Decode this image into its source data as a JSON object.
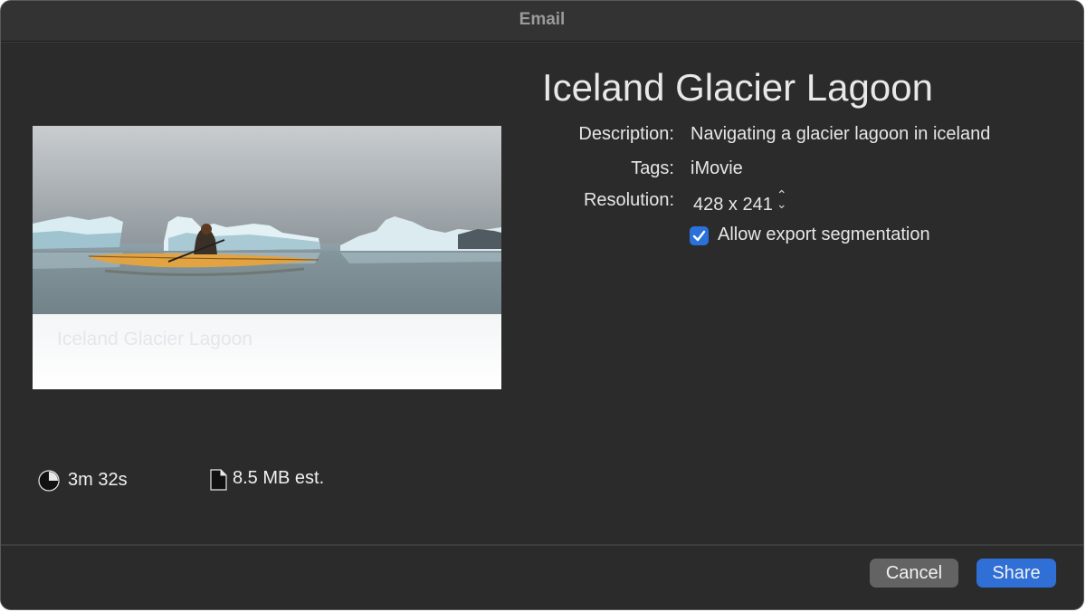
{
  "window": {
    "title": "Email"
  },
  "preview": {
    "caption": "Iceland Glacier Lagoon"
  },
  "details": {
    "title": "Iceland Glacier Lagoon",
    "description_label": "Description:",
    "description_value": "Navigating a glacier lagoon in iceland",
    "tags_label": "Tags:",
    "tags_value": "iMovie",
    "resolution_label": "Resolution:",
    "resolution_value": "428 x 241",
    "export_segmentation_label": "Allow export segmentation",
    "export_segmentation_checked": true
  },
  "stats": {
    "duration": "3m 32s",
    "duration_icon": "clock-icon",
    "file_size": "8.5 MB est.",
    "file_size_icon": "document-icon"
  },
  "buttons": {
    "cancel": "Cancel",
    "share": "Share"
  },
  "colors": {
    "accent": "#2f6fd6",
    "window_bg": "#2b2b2b"
  }
}
